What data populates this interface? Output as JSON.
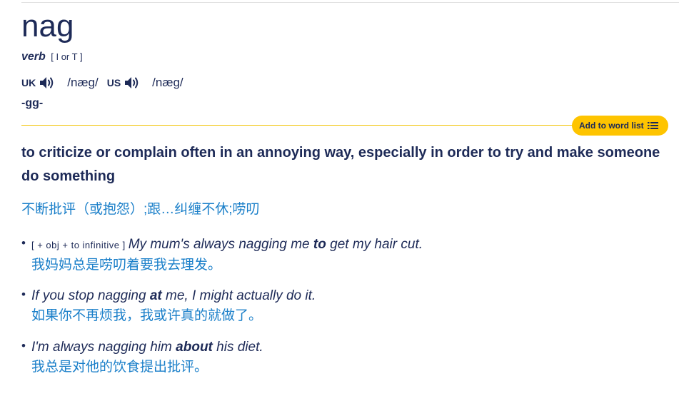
{
  "entry": {
    "headword": "nag",
    "pos": "verb",
    "grammar": "[ I or T ]",
    "uk_label": "UK",
    "uk_ipa": "/næɡ/",
    "us_label": "US",
    "us_ipa": "/næɡ/",
    "inflection": "-gg-",
    "speaker_icon": "speaker-icon"
  },
  "add_to_word_list": {
    "label": "Add to word list",
    "icon": "list-icon",
    "accent": "#fec400"
  },
  "definition": {
    "text": "to criticize or complain often in an annoying way, especially in order to try and make someone do something",
    "translation": "不断批评（或抱怨）;跟…纠缠不休;唠叨"
  },
  "examples": [
    {
      "grammar": "[ + obj + to infinitive ]",
      "pre": "My mum's always nagging me ",
      "bold": "to",
      "post": " get my hair cut.",
      "translation": "我妈妈总是唠叨着要我去理发。"
    },
    {
      "grammar": "",
      "pre": "If you stop nagging ",
      "bold": "at",
      "post": " me, I might actually do it.",
      "translation": "如果你不再烦我，我或许真的就做了。"
    },
    {
      "grammar": "",
      "pre": "I'm always nagging him ",
      "bold": "about",
      "post": " his diet.",
      "translation": "我总是对他的饮食提出批评。"
    }
  ],
  "colors": {
    "text": "#1d2a57",
    "translation": "#1a7fc9",
    "rule": "#f2c200"
  }
}
